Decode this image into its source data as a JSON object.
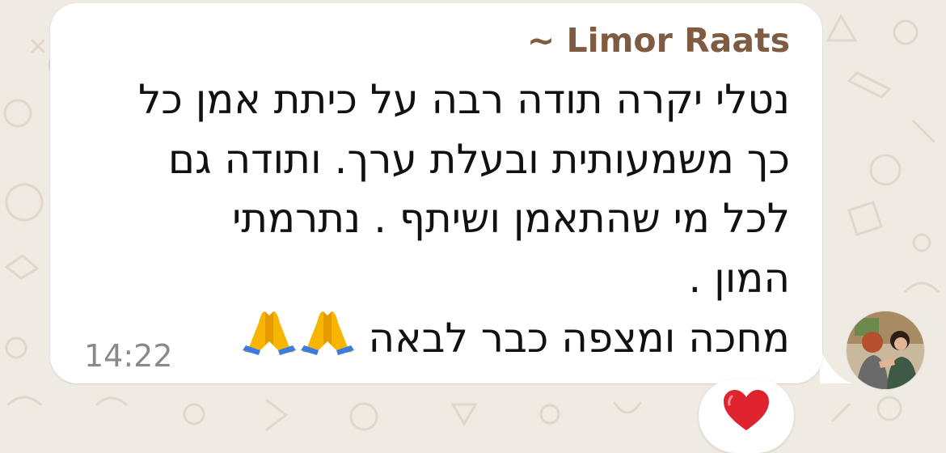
{
  "chat": {
    "background_color": "#efeae2",
    "bubble_color": "#ffffff",
    "sender_color": "#7e5b41"
  },
  "message": {
    "sender": "~ Limor Raats",
    "lines": [
      "נטלי יקרה תודה רבה על כיתת אמן כל",
      "כך משמעותית ובעלת ערך.  ותודה גם",
      "לכל מי שהתאמן ושיתף . נתרמתי",
      "המון .",
      "מחכה ומצפה כבר לבאה"
    ],
    "trailing_emojis": [
      "folded-hands-icon",
      "folded-hands-icon"
    ],
    "time": "14:22"
  },
  "reaction": {
    "emoji": "red-heart-icon"
  },
  "avatar": {
    "icon": "profile-photo"
  }
}
